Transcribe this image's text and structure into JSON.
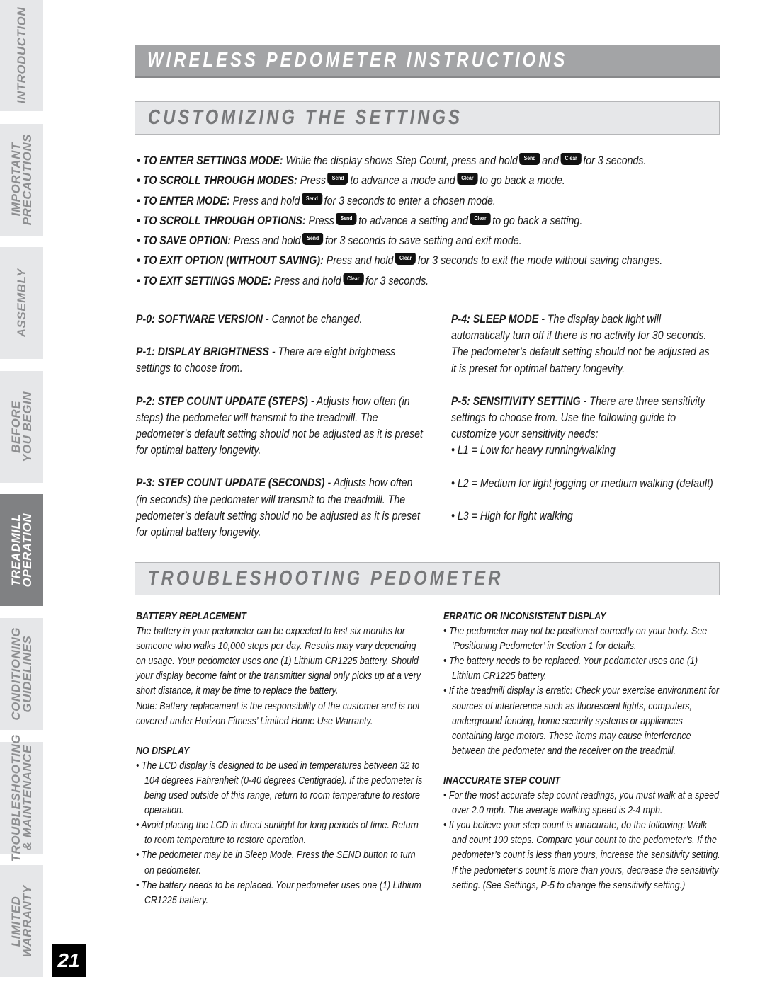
{
  "sidebar": {
    "tabs": [
      {
        "label": "INTRODUCTION",
        "active": false
      },
      {
        "label": "IMPORTANT\nPRECAUTIONS",
        "active": false
      },
      {
        "label": "ASSEMBLY",
        "active": false
      },
      {
        "label": "BEFORE\nYOU BEGIN",
        "active": false
      },
      {
        "label": "TREADMILL\nOPERATION",
        "active": true
      },
      {
        "label": "CONDITIONING\nGUIDELINES",
        "active": false
      },
      {
        "label": "TROUBLESHOOTING\n& MAINTENANCE",
        "active": false
      },
      {
        "label": "LIMITED\nWARRANTY",
        "active": false
      }
    ]
  },
  "page_number": "21",
  "title": "WIRELESS PEDOMETER INSTRUCTIONS",
  "customizing": {
    "heading": "CUSTOMIZING THE SETTINGS",
    "keys": {
      "send": "Send",
      "clear": "Clear"
    },
    "instructions": [
      {
        "label": "• TO ENTER SETTINGS MODE:",
        "t1": " While the display shows Step Count, press and hold",
        "mid": "and",
        "t2": "for 3 seconds."
      },
      {
        "label": "• TO SCROLL THROUGH MODES:",
        "t1": " Press",
        "mid": "to advance a mode and",
        "t2": "to go back a mode."
      },
      {
        "label": "• TO ENTER MODE:",
        "t1": " Press and hold",
        "t2": "for 3 seconds to enter a chosen mode."
      },
      {
        "label": "• TO SCROLL THROUGH OPTIONS:",
        "t1": " Press",
        "mid": "to advance a setting and",
        "t2": "to go back a setting."
      },
      {
        "label": "• TO SAVE OPTION:",
        "t1": " Press and hold",
        "t2": "for 3 seconds to save setting and exit mode."
      },
      {
        "label": "• TO EXIT OPTION (WITHOUT SAVING):",
        "t1": " Press and hold",
        "t2": "for 3 seconds to exit the mode without saving changes."
      },
      {
        "label": "• TO EXIT SETTINGS MODE:",
        "t1": " Press and hold",
        "t2": "for 3 seconds."
      }
    ],
    "settings": [
      {
        "code": "P-0: SOFTWARE VERSION",
        "desc": " - Cannot be changed."
      },
      {
        "code": "P-1: DISPLAY BRIGHTNESS",
        "desc": " - There are eight brightness settings to choose from."
      },
      {
        "code": "P-2: STEP COUNT UPDATE (STEPS)",
        "desc": " - Adjusts how often (in steps) the pedometer will transmit to the treadmill. The pedometer’s default setting should not be adjusted as it is preset for optimal battery longevity."
      },
      {
        "code": "P-3: STEP COUNT UPDATE (SECONDS)",
        "desc": " - Adjusts how often (in seconds) the pedometer will transmit to the treadmill. The pedometer’s default setting should no be adjusted as it is preset for optimal battery longevity."
      },
      {
        "code": "P-4: SLEEP MODE",
        "desc": " - The display back light will automatically turn off if there is no activity for 30 seconds. The pedometer’s default setting should not be adjusted as it is preset for optimal battery longevity."
      },
      {
        "code": "P-5: SENSITIVITY SETTING",
        "desc": " - There are three sensitivity settings to choose from. Use the following guide to customize your sensitivity needs:"
      }
    ],
    "levels": [
      "• L1 = Low for heavy running/walking",
      "• L2 = Medium for light jogging or medium walking (default)",
      "• L3 = High for light walking"
    ]
  },
  "troubleshooting": {
    "heading": "TROUBLESHOOTING PEDOMETER",
    "battery": {
      "title": "BATTERY REPLACEMENT",
      "body": "The battery in your pedometer can be expected to last six months for someone who walks 10,000 steps per day.  Results may vary depending on usage.  Your pedometer uses one (1) Lithium CR1225 battery.  Should your display become faint or the transmitter signal only picks up at a very short distance, it may be time to replace the battery.",
      "note": "Note: Battery replacement is the responsibility of the customer and is not covered under Horizon Fitness’ Limited Home Use Warranty."
    },
    "no_display": {
      "title": "NO DISPLAY",
      "bullets": [
        "• The LCD display is designed to be used in temperatures between 32 to 104 degrees Fahrenheit (0-40 degrees Centigrade).  If the pedometer is being used outside of this range, return to room temperature to restore operation.",
        "• Avoid placing the LCD in direct sunlight for long periods of time.  Return to room temperature to restore operation.",
        "• The pedometer may be in Sleep Mode.  Press the SEND button to turn on pedometer.",
        "• The battery needs to be replaced.  Your pedometer uses one (1) Lithium CR1225 battery."
      ]
    },
    "erratic": {
      "title": "ERRATIC OR INCONSISTENT DISPLAY",
      "bullets": [
        "• The pedometer may not be positioned correctly on your body. See ‘Positioning Pedometer’ in Section 1 for details.",
        "• The battery needs to be replaced.  Your pedometer uses one (1) Lithium CR1225 battery.",
        "• If the treadmill display is erratic: Check your exercise environment for sources of interference such as fluorescent lights, computers, underground fencing, home security systems or appliances containing large motors. These items may cause interference between the pedometer and the receiver on the treadmill."
      ]
    },
    "inaccurate": {
      "title": "INACCURATE STEP COUNT",
      "bullets": [
        "• For the most accurate step count readings, you must walk at a speed over 2.0 mph. The average walking speed is 2-4 mph.",
        "• If you believe your step count is innacurate, do the following: Walk and count 100 steps. Compare your count to the pedometer’s. If the pedometer’s count is less than yours, increase the sensitivity setting. If the pedometer’s count is more than yours, decrease the sensitivity setting. (See Settings, P-5 to change the sensitivity setting.)"
      ]
    }
  }
}
